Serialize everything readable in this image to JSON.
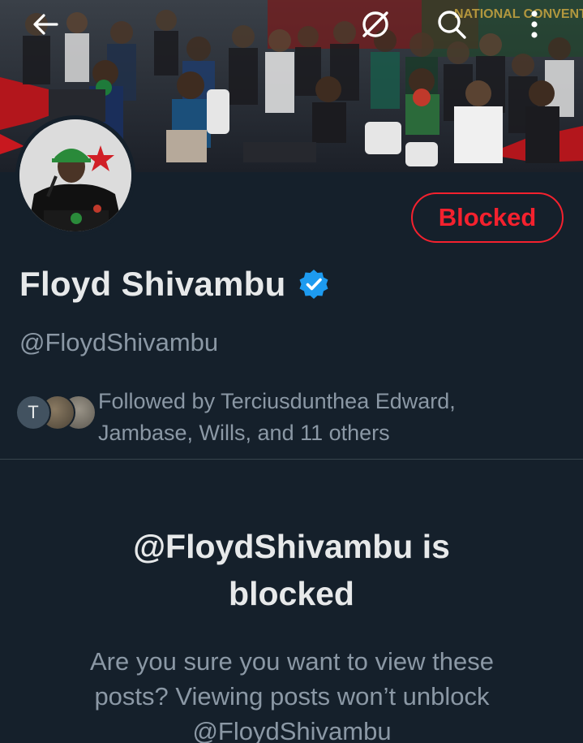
{
  "profile": {
    "display_name": "Floyd Shivambu",
    "handle": "@FloydShivambu",
    "verified": true,
    "relationship_button": "Blocked",
    "banner_text": "NATIONAL CONVENTION"
  },
  "topbar": {
    "back_icon": "arrow-left-icon",
    "grok_icon": "grok-icon",
    "search_icon": "search-icon",
    "more_icon": "more-vertical-icon"
  },
  "followed_by": {
    "initial": "T",
    "line1": "Followed by Terciusdunthea Edward,",
    "line2": "Jambase, Wills, and 11 others"
  },
  "blocked_notice": {
    "title_line1": "@FloydShivambu is",
    "title_line2": "blocked",
    "desc_line1": "Are you sure you want to view these",
    "desc_line2": "posts? Viewing posts won’t unblock",
    "desc_line3": "@FloydShivambu"
  },
  "colors": {
    "background": "#15202b",
    "blocked_red": "#f4212e",
    "verified_blue": "#1d9bf0",
    "secondary_text": "#8b98a5",
    "primary_text": "#e7e9ea"
  }
}
